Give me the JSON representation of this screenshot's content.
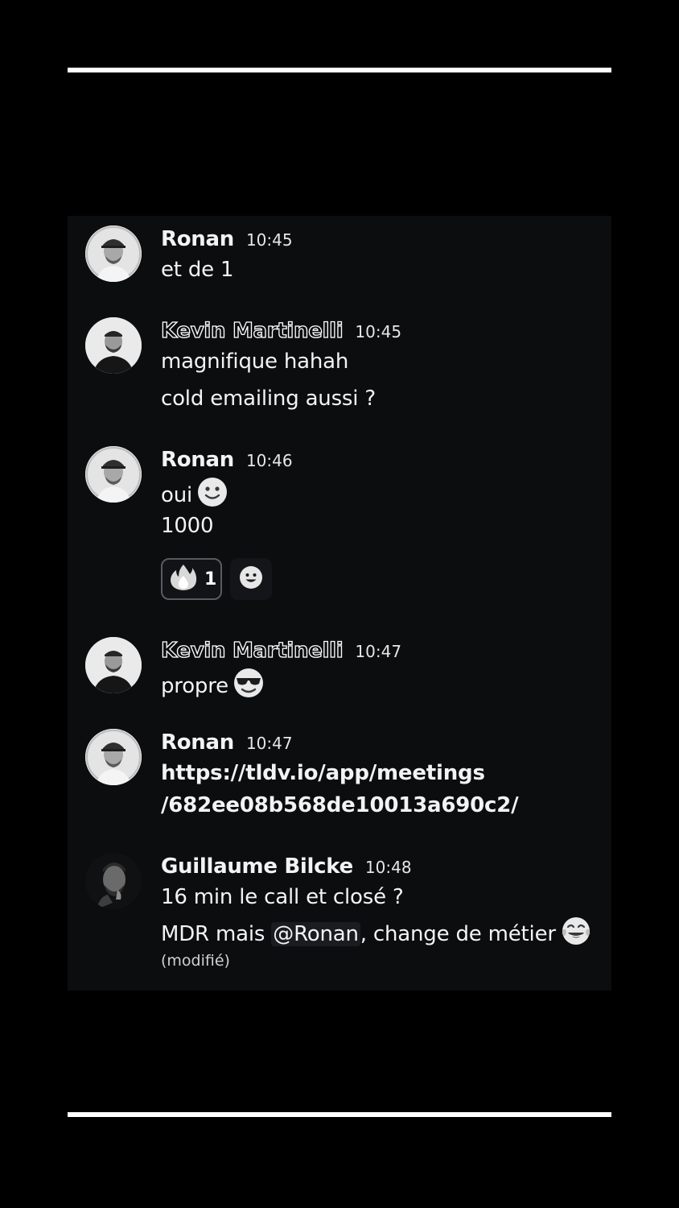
{
  "messages": [
    {
      "author": "Ronan",
      "time": "10:45",
      "lines": [
        "et de 1"
      ]
    },
    {
      "author": "Kevin Martinelli",
      "time": "10:45",
      "lines": [
        "magnifique hahah",
        "cold emailing aussi ?"
      ]
    },
    {
      "author": "Ronan",
      "time": "10:46",
      "lines": [
        "oui",
        "1000"
      ],
      "emoji": "slightly-smiling-face-icon",
      "reaction": {
        "emoji": "fire-icon",
        "count": "1"
      }
    },
    {
      "author": "Kevin Martinelli",
      "time": "10:47",
      "lines": [
        "propre"
      ],
      "emoji": "sunglasses-face-icon"
    },
    {
      "author": "Ronan",
      "time": "10:47",
      "lines": [
        "https://tldv.io/app/meetings",
        "/682ee08b568de10013a690c2/"
      ]
    },
    {
      "author": "Guillaume Bilcke",
      "time": "10:48",
      "lines": [
        "16 min le call et closé ?"
      ],
      "line2_before": "MDR mais ",
      "mention": "@Ronan",
      "line2_after": ", change de métier",
      "emoji": "face-with-tears-of-joy-icon",
      "edited": "(modifié)"
    }
  ],
  "colors": {
    "background": "#000000",
    "chat_background": "#0c0d0f",
    "text": "#f2f3f5",
    "reaction_border": "#5a5b5f"
  }
}
